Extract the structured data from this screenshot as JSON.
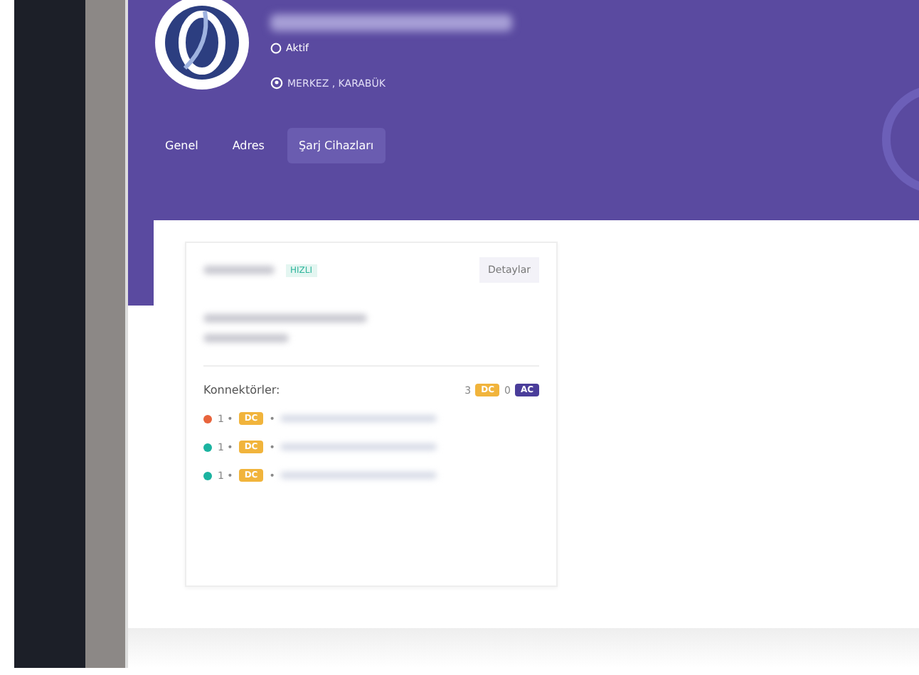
{
  "profile": {
    "status": "Aktif",
    "location": "MERKEZ , KARABÜK"
  },
  "tabs": [
    {
      "label": "Genel",
      "selected": false
    },
    {
      "label": "Adres",
      "selected": false
    },
    {
      "label": "Şarj Cihazları",
      "selected": true
    }
  ],
  "device": {
    "speed_badge": "HIZLI",
    "details_button": "Detaylar",
    "connectors_label": "Konnektörler:",
    "dc_count": "3",
    "dc_label": "DC",
    "ac_count": "0",
    "ac_label": "AC",
    "connectors": [
      {
        "count": "1 •",
        "type": "DC",
        "separator": "•",
        "color": "#e8643c"
      },
      {
        "count": "1 •",
        "type": "DC",
        "separator": "•",
        "color": "#1bb3a0"
      },
      {
        "count": "1 •",
        "type": "DC",
        "separator": "•",
        "color": "#1bb3a0"
      }
    ]
  }
}
